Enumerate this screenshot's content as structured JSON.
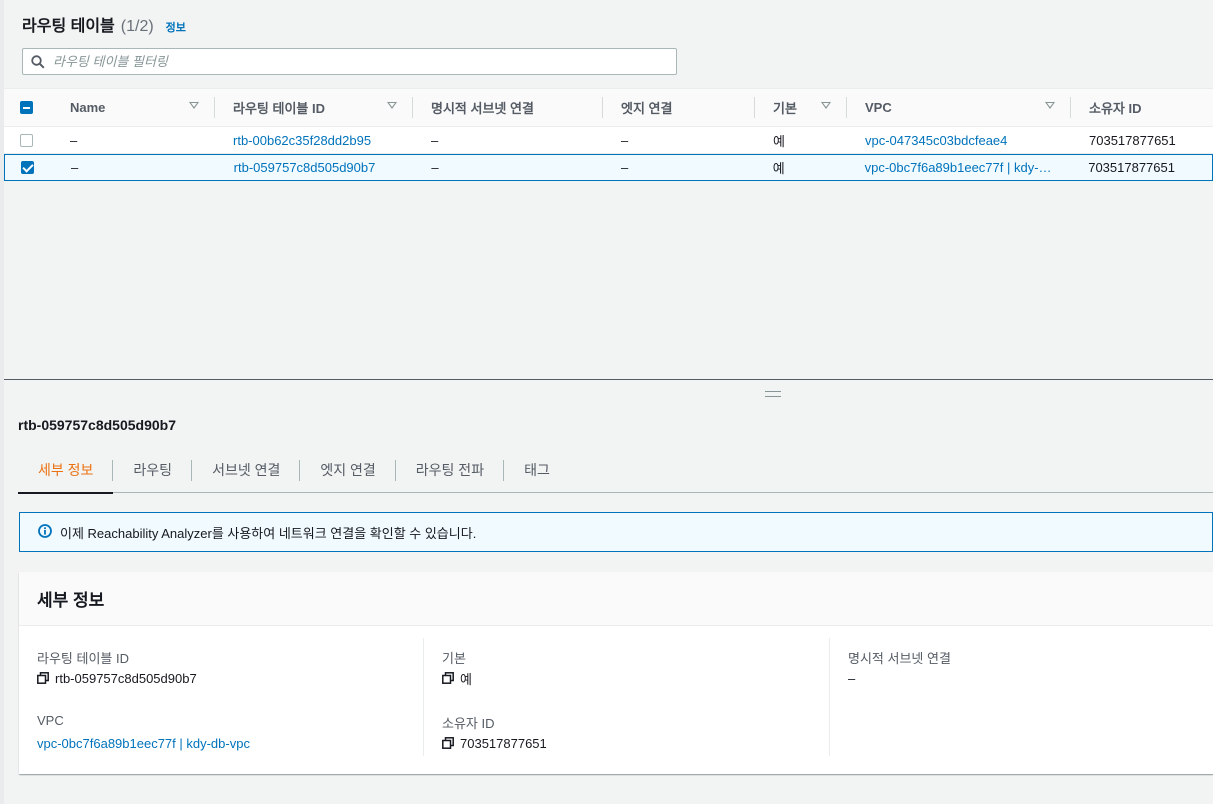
{
  "header": {
    "title": "라우팅 테이블",
    "count": "(1/2)",
    "info_label": "정보"
  },
  "filter": {
    "placeholder": "라우팅 테이블 필터링"
  },
  "table": {
    "columns": [
      "Name",
      "라우팅 테이블 ID",
      "명시적 서브넷 연결",
      "엣지 연결",
      "기본",
      "VPC",
      "소유자 ID"
    ],
    "rows": [
      {
        "name": "–",
        "rtb_id": "rtb-00b62c35f28dd2b95",
        "explicit": "–",
        "edge": "–",
        "main": "예",
        "vpc": "vpc-047345c03bdcfeae4",
        "owner": "703517877651",
        "selected": false
      },
      {
        "name": "–",
        "rtb_id": "rtb-059757c8d505d90b7",
        "explicit": "–",
        "edge": "–",
        "main": "예",
        "vpc": "vpc-0bc7f6a89b1eec77f | kdy-…",
        "owner": "703517877651",
        "selected": true
      }
    ]
  },
  "detail": {
    "id": "rtb-059757c8d505d90b7",
    "tabs": [
      "세부 정보",
      "라우팅",
      "서브넷 연결",
      "엣지 연결",
      "라우팅 전파",
      "태그"
    ],
    "active_tab": "세부 정보",
    "banner": "이제 Reachability Analyzer를 사용하여 네트워크 연결을 확인할 수 있습니다.",
    "card_title": "세부 정보",
    "fields": {
      "rtb_label": "라우팅 테이블 ID",
      "rtb_value": "rtb-059757c8d505d90b7",
      "vpc_label": "VPC",
      "vpc_value": "vpc-0bc7f6a89b1eec77f | kdy-db-vpc",
      "main_label": "기본",
      "main_value": "예",
      "owner_label": "소유자 ID",
      "owner_value": "703517877651",
      "explicit_label": "명시적 서브넷 연결",
      "explicit_value": "–"
    }
  },
  "colors": {
    "link": "#0073bb",
    "active_tab": "#ec7211",
    "selected_row_bg": "#f1faff"
  }
}
